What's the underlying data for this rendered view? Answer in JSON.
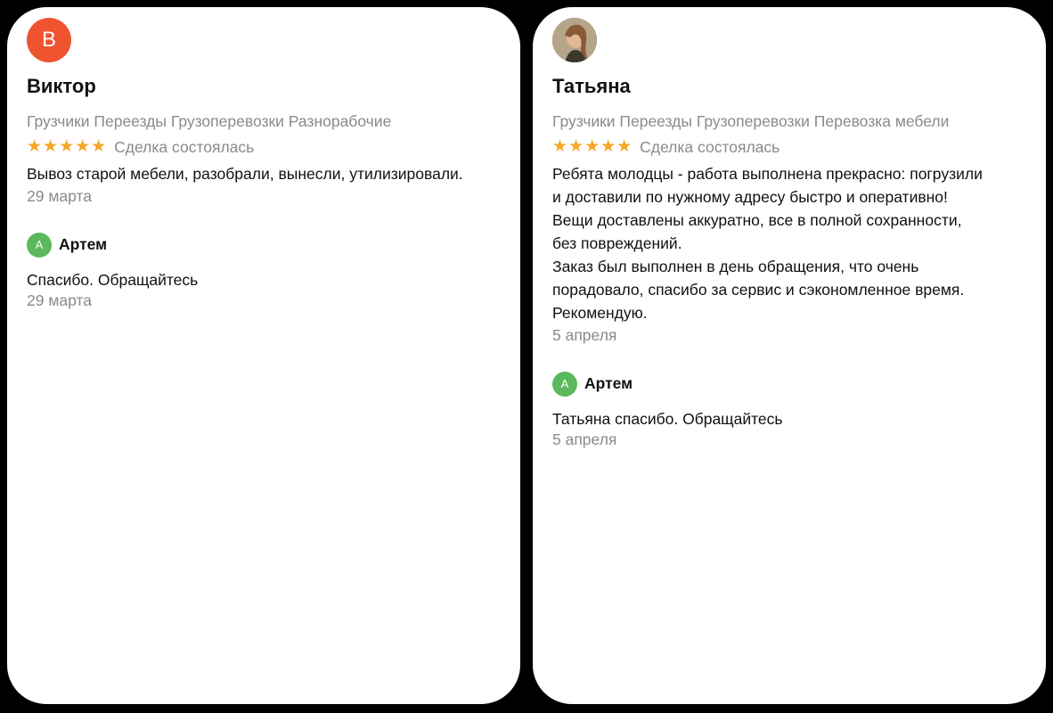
{
  "reviews": [
    {
      "avatar_letter": "В",
      "avatar_color": "#f0532f",
      "author": "Виктор",
      "categories": "Грузчики Переезды Грузоперевозки Разнорабочие",
      "stars": "★★★★★",
      "rating": 5,
      "deal_status": "Сделка состоялась",
      "text": "Вывоз старой мебели, разобрали, вынесли, утилизировали.",
      "date": "29 марта",
      "reply": {
        "avatar_letter": "А",
        "author": "Артем",
        "text": "Спасибо. Обращайтесь",
        "date": "29 марта"
      }
    },
    {
      "avatar_type": "photo",
      "author": "Татьяна",
      "categories": "Грузчики Переезды Грузоперевозки Перевозка мебели",
      "stars": "★★★★★",
      "rating": 5,
      "deal_status": "Сделка состоялась",
      "text": "Ребята молодцы - работа выполнена прекрасно: погрузили\nи доставили по нужному адресу быстро и оперативно!\nВещи доставлены аккуратно, все в полной сохранности,\nбез повреждений.\nЗаказ был выполнен в день обращения, что очень\nпорадовало, спасибо за сервис и  сэкономленное время.\nРекомендую.",
      "date": "5 апреля",
      "reply": {
        "avatar_letter": "А",
        "author": "Артем",
        "text": "Татьяна спасибо. Обращайтесь",
        "date": "5 апреля"
      }
    }
  ],
  "colors": {
    "star": "#f5a623",
    "reply_avatar": "#5cb85c",
    "muted_text": "#8a8a8a"
  }
}
